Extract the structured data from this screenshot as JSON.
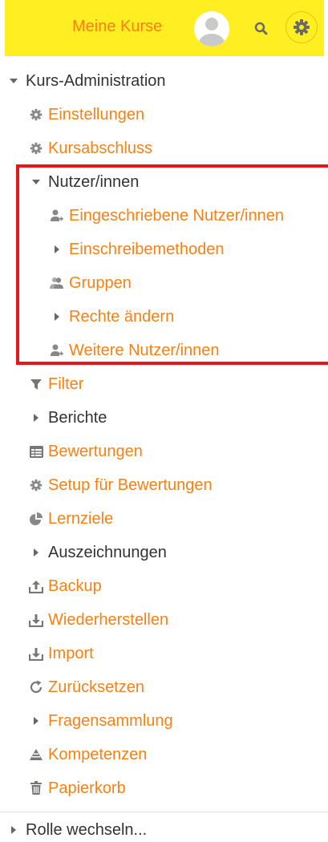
{
  "header": {
    "link_label": "Meine Kurse",
    "background": "#ffee22",
    "accent": "#f98012"
  },
  "menu": {
    "section_label": "Kurs-Administration",
    "items": [
      {
        "label": "Einstellungen",
        "icon": "gear-icon"
      },
      {
        "label": "Kursabschluss",
        "icon": "gear-icon"
      },
      {
        "label": "Nutzer/innen",
        "icon": "caret-down-icon"
      },
      {
        "label": "Eingeschriebene Nutzer/innen",
        "icon": "user-plus-icon"
      },
      {
        "label": "Einschreibemethoden",
        "icon": "caret-right-icon"
      },
      {
        "label": "Gruppen",
        "icon": "users-icon"
      },
      {
        "label": "Rechte ändern",
        "icon": "caret-right-icon"
      },
      {
        "label": "Weitere Nutzer/innen",
        "icon": "user-plus-icon"
      },
      {
        "label": "Filter",
        "icon": "filter-icon"
      },
      {
        "label": "Berichte",
        "icon": "caret-right-icon"
      },
      {
        "label": "Bewertungen",
        "icon": "table-icon"
      },
      {
        "label": "Setup für Bewertungen",
        "icon": "gear-icon"
      },
      {
        "label": "Lernziele",
        "icon": "pie-chart-icon"
      },
      {
        "label": "Auszeichnungen",
        "icon": "caret-right-icon"
      },
      {
        "label": "Backup",
        "icon": "upload-icon"
      },
      {
        "label": "Wiederherstellen",
        "icon": "download-icon"
      },
      {
        "label": "Import",
        "icon": "download-icon"
      },
      {
        "label": "Zurücksetzen",
        "icon": "refresh-icon"
      },
      {
        "label": "Fragensammlung",
        "icon": "caret-right-icon"
      },
      {
        "label": "Kompetenzen",
        "icon": "triangle-icon"
      },
      {
        "label": "Papierkorb",
        "icon": "trash-icon"
      }
    ],
    "footer_label": "Rolle wechseln..."
  }
}
